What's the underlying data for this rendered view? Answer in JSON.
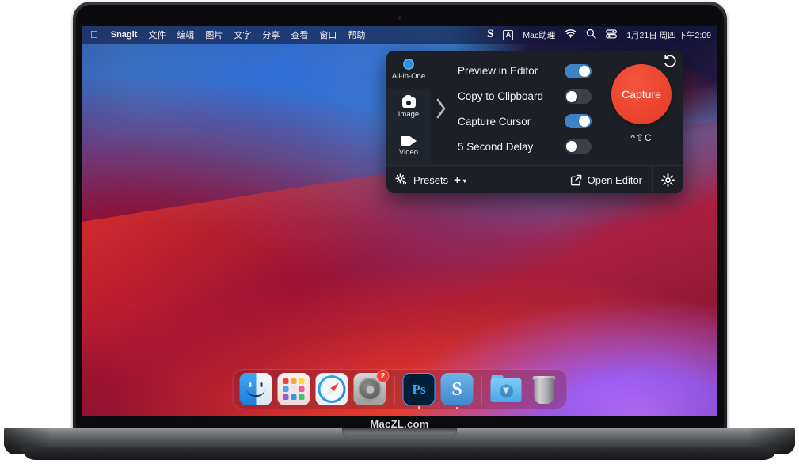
{
  "device": {
    "bezel_label": "MacZL.com"
  },
  "menubar": {
    "apple_icon": "apple-logo-icon",
    "items": [
      {
        "label": "Snagit",
        "bold": true
      },
      {
        "label": "文件"
      },
      {
        "label": "编辑"
      },
      {
        "label": "图片"
      },
      {
        "label": "文字"
      },
      {
        "label": "分享"
      },
      {
        "label": "查看"
      },
      {
        "label": "窗口"
      },
      {
        "label": "帮助"
      }
    ],
    "status": {
      "snagit_letter": "S",
      "input_source": "A",
      "assistant": "Mac助理",
      "wifi_icon": "wifi-icon",
      "search_icon": "search-icon",
      "control_center_icon": "control-center-icon",
      "datetime": "1月21日 周四 下午2:09"
    }
  },
  "snagit_panel": {
    "modes": [
      {
        "label": "All-in-One",
        "icon": "radio-selected-icon",
        "active": true
      },
      {
        "label": "Image",
        "icon": "camera-icon",
        "active": false
      },
      {
        "label": "Video",
        "icon": "video-camera-icon",
        "active": false
      }
    ],
    "chevron_icon": "chevron-right-icon",
    "options": [
      {
        "label": "Preview in Editor",
        "state": "on"
      },
      {
        "label": "Copy to Clipboard",
        "state": "off"
      },
      {
        "label": "Capture Cursor",
        "state": "on"
      },
      {
        "label": "5 Second Delay",
        "state": "off"
      }
    ],
    "undo_icon": "undo-icon",
    "capture_button": "Capture",
    "capture_shortcut": "^⇧C",
    "footer": {
      "presets_icon": "presets-gear-icon",
      "presets_label": "Presets",
      "add_preset": "+",
      "add_preset_caret": "▾",
      "open_editor_icon": "open-external-icon",
      "open_editor_label": "Open Editor",
      "settings_icon": "gear-icon"
    },
    "colors": {
      "panel_bg": "#1c1f26",
      "toggle_on": "#3d84c6",
      "toggle_off": "#3c4048",
      "capture_red": "#ef4630",
      "accent_blue": "#2a8fe0"
    }
  },
  "dock": {
    "items": [
      {
        "name": "finder",
        "label": "Finder",
        "running": true,
        "badge": null
      },
      {
        "name": "launchpad",
        "label": "Launchpad",
        "running": false,
        "badge": null
      },
      {
        "name": "safari",
        "label": "Safari",
        "running": false,
        "badge": null
      },
      {
        "name": "system-preferences",
        "label": "System Preferences",
        "running": false,
        "badge": "2"
      },
      {
        "name": "separator",
        "label": "",
        "running": false,
        "badge": null
      },
      {
        "name": "photoshop",
        "label": "Adobe Photoshop",
        "running": true,
        "badge": null
      },
      {
        "name": "snagit",
        "label": "Snagit",
        "running": true,
        "badge": null
      },
      {
        "name": "separator",
        "label": "",
        "running": false,
        "badge": null
      },
      {
        "name": "downloads",
        "label": "Downloads",
        "running": false,
        "badge": null
      },
      {
        "name": "trash",
        "label": "Trash",
        "running": false,
        "badge": null
      }
    ]
  }
}
